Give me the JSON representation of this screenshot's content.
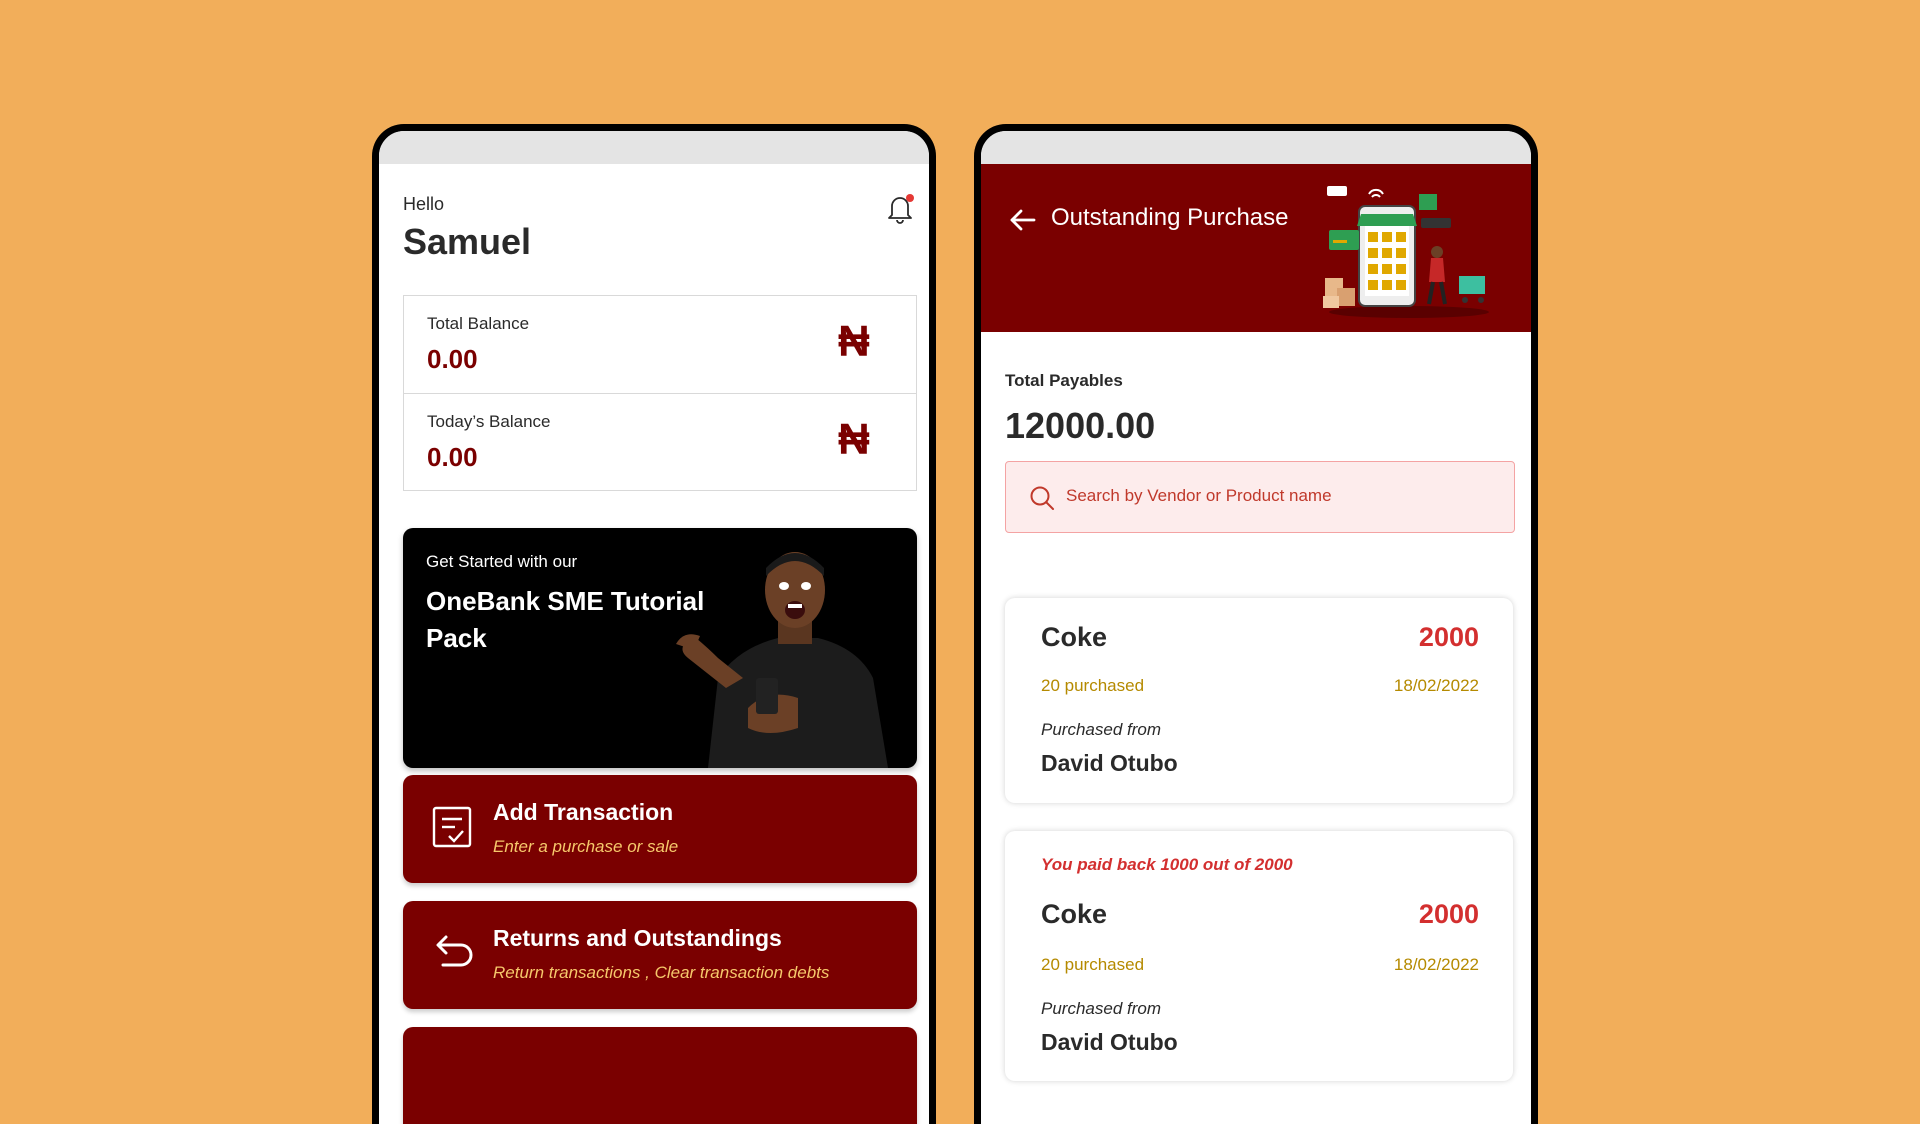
{
  "home": {
    "greeting": "Hello",
    "user_name": "Samuel",
    "balances": [
      {
        "label": "Total Balance",
        "value": "0.00",
        "currency_symbol": "₦"
      },
      {
        "label": "Today’s Balance",
        "value": "0.00",
        "currency_symbol": "₦"
      }
    ],
    "tutorial": {
      "small_text": "Get Started with our",
      "title": "OneBank SME Tutorial Pack"
    },
    "actions": [
      {
        "title": "Add Transaction",
        "subtitle": "Enter a purchase or sale",
        "icon": "checklist-icon"
      },
      {
        "title": "Returns and Outstandings",
        "subtitle": "Return transactions , Clear transaction debts",
        "icon": "return-arrow-icon"
      }
    ]
  },
  "outstanding": {
    "title": "Outstanding Purchase",
    "total_label": "Total Payables",
    "total_value": "12000.00",
    "search_placeholder": "Search by Vendor or Product name",
    "items": [
      {
        "note": "",
        "product": "Coke",
        "amount": "2000",
        "quantity": "20 purchased",
        "date": "18/02/2022",
        "from_label": "Purchased from",
        "vendor": "David Otubo"
      },
      {
        "note": "You paid back 1000 out of 2000",
        "product": "Coke",
        "amount": "2000",
        "quantity": "20 purchased",
        "date": "18/02/2022",
        "from_label": "Purchased from",
        "vendor": "David Otubo"
      }
    ]
  },
  "colors": {
    "background": "#F2AE5A",
    "brand": "#7A0000",
    "accent_red": "#D32F2F",
    "gold": "#B58A00",
    "search_bg": "#FDECEC"
  }
}
